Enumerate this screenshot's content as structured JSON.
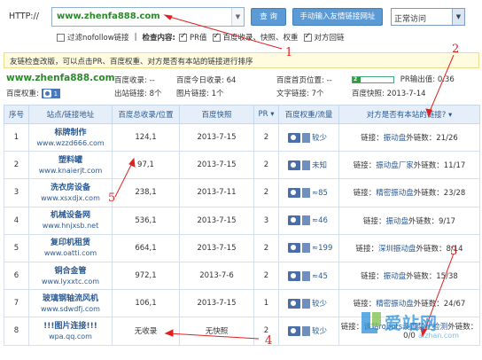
{
  "search": {
    "http_label": "HTTP://",
    "url_value": "www.zhenfa888.com",
    "query_button": "查 询",
    "manual_button": "手动输入友情链接网址",
    "mode_select": "正常访问"
  },
  "options": {
    "nofollow": "过滤nofollow链接",
    "separator": "|",
    "check_title": "检查内容:",
    "items": [
      {
        "label": "PR值",
        "checked": true
      },
      {
        "label": "百度收录、快照、权重",
        "checked": true
      },
      {
        "label": "对方回链",
        "checked": true
      }
    ]
  },
  "notice": "友链检查改版，可以点击PR、百度权重、对方是否有本站的链接进行排序",
  "summary": {
    "site": "www.zhenfa888.com",
    "baidu_weight_label": "百度权重:",
    "baidu_weight_value": "1",
    "baidu_index_label": "百度收录:",
    "baidu_index_value": "--",
    "baidu_today_label": "百度今日收录:",
    "baidu_today_value": "64",
    "baidu_home_label": "百度首页位置:",
    "baidu_home_value": "--",
    "pr_label": "PR",
    "pr_value": "2",
    "pr_out_label": "PR输出值:",
    "pr_out_value": "0.36",
    "out_links_label": "出站链接:",
    "out_links_value": "8个",
    "img_links_label": "图片链接:",
    "img_links_value": "1个",
    "text_links_label": "文字链接:",
    "text_links_value": "7个",
    "snapshot_label": "百度快照:",
    "snapshot_value": "2013-7-14"
  },
  "table": {
    "headers": [
      "序号",
      "站点/链接地址",
      "百度总收录/位置",
      "百度快照",
      "PR ▾",
      "百度权重/流量",
      "对方是否有本站的链接? ▾"
    ],
    "rows": [
      {
        "idx": "1",
        "name": "标牌制作",
        "url": "www.wzzd666.com",
        "index": "124,1",
        "index_red": false,
        "snapshot": "2013-7-15",
        "snapshot_red": false,
        "pr": "2",
        "weight": "0",
        "traffic": "较少",
        "link_label": "链接：",
        "link_kw": "振动盘",
        "out_count": "外链数：21/26"
      },
      {
        "idx": "2",
        "name": "塑料罐",
        "url": "www.knaierjt.com",
        "index": "97,1",
        "index_red": true,
        "snapshot": "2013-7-15",
        "snapshot_red": false,
        "pr": "2",
        "weight": "0",
        "traffic": "未知",
        "link_label": "链接：",
        "link_kw": "振动盘厂家",
        "out_count": "外链数：11/17"
      },
      {
        "idx": "3",
        "name": "洗衣房设备",
        "url": "www.xsxdjx.com",
        "index": "238,1",
        "index_red": false,
        "snapshot": "2013-7-11",
        "snapshot_red": false,
        "pr": "2",
        "weight": "1",
        "traffic": "≈85",
        "link_label": "链接：",
        "link_kw": "精密振动盘",
        "out_count": "外链数：23/28"
      },
      {
        "idx": "4",
        "name": "机械设备网",
        "url": "www.hnjxsb.net",
        "index": "536,1",
        "index_red": false,
        "snapshot": "2013-7-15",
        "snapshot_red": false,
        "pr": "3",
        "weight": "1",
        "traffic": "≈46",
        "link_label": "链接：",
        "link_kw": "振动盘",
        "out_count": "外链数：9/17"
      },
      {
        "idx": "5",
        "name": "复印机租赁",
        "url": "www.oatti.com",
        "index": "664,1",
        "index_red": false,
        "snapshot": "2013-7-15",
        "snapshot_red": false,
        "pr": "2",
        "weight": "2",
        "traffic": "≈199",
        "link_label": "链接：",
        "link_kw": "深圳振动盘",
        "out_count": "外链数：8/14"
      },
      {
        "idx": "6",
        "name": "铜合金管",
        "url": "www.lyxxtc.com",
        "index": "972,1",
        "index_red": false,
        "snapshot": "2013-7-6",
        "snapshot_red": true,
        "pr": "2",
        "weight": "1",
        "traffic": "≈45",
        "link_label": "链接：",
        "link_kw": "振动盘",
        "out_count": "外链数：15/38"
      },
      {
        "idx": "7",
        "name": "玻璃钢轴流风机",
        "url": "www.sdwdfj.com",
        "index": "106,1",
        "index_red": false,
        "snapshot": "2013-7-15",
        "snapshot_red": false,
        "pr": "1",
        "weight": "0",
        "traffic": "较少",
        "link_label": "链接：",
        "link_kw": "精密振动盘",
        "out_count": "外链数：24/67"
      },
      {
        "idx": "8",
        "name": "!!!图片连接!!!",
        "url": "wpa.qq.com",
        "index": "无收录",
        "index_red": true,
        "snapshot": "无快照",
        "snapshot_red": true,
        "pr": "2",
        "weight": "0",
        "traffic": "较少",
        "link_label": "链接：",
        "link_kw": "该站robots设置禁止检测",
        "out_count": "外链数：0/0"
      }
    ]
  },
  "annotations": {
    "n1": "1",
    "n2": "2",
    "n3": "3",
    "n4": "4",
    "n5": "5",
    "color": "#e02020"
  },
  "watermark": {
    "text": "爱站网",
    "sub": "aizhan.com"
  },
  "colors": {
    "accent": "#5b9ad4",
    "header_bg": "#e6eff9",
    "link": "#2a5a94",
    "green": "#2a8a2a",
    "red": "#e03030"
  }
}
